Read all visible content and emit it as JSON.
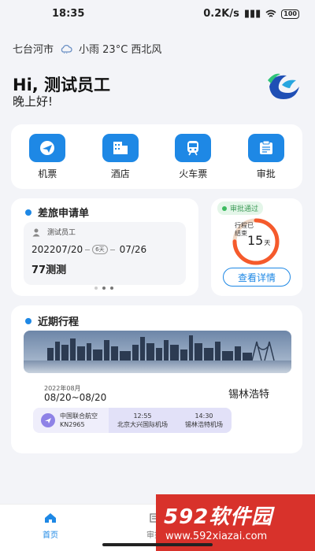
{
  "status_bar": {
    "time": "18:35",
    "speed": "0.2K/s",
    "battery": "100"
  },
  "weather": {
    "city": "七台河市",
    "condition": "小雨 23°C 西北风"
  },
  "greeting": {
    "hello": "Hi, 测试员工",
    "sub": "晚上好!"
  },
  "quick_actions": [
    {
      "label": "机票",
      "icon": "plane-icon"
    },
    {
      "label": "酒店",
      "icon": "hotel-icon"
    },
    {
      "label": "火车票",
      "icon": "train-icon"
    },
    {
      "label": "审批",
      "icon": "approval-icon"
    }
  ],
  "travel_request": {
    "title": "差旅申请单",
    "user": "测试员工",
    "date_start": "202207/20",
    "days": "6天",
    "date_end": "07/26",
    "name": "77测测"
  },
  "status_card": {
    "badge": "审批通过",
    "label_line1": "行程已",
    "label_line2": "结束",
    "days_value": "15",
    "days_unit": "天",
    "button": "查看详情",
    "progress": 0.75
  },
  "recent_trip": {
    "title": "近期行程",
    "month": "2022年08月",
    "date_range": "08/20~08/20",
    "destination": "锡林浩特",
    "airline": "中国联合航空",
    "flight_no": "KN2965",
    "dep_time": "12:55",
    "dep_airport": "北京大兴国际机场",
    "arr_time": "14:30",
    "arr_airport": "锡林浩特机场"
  },
  "tabbar": [
    {
      "label": "首页",
      "icon": "home-icon"
    },
    {
      "label": "审批",
      "icon": "approval-tab-icon"
    }
  ],
  "watermark": {
    "brand": "592软件园",
    "url": "www.592xiazai.com"
  },
  "colors": {
    "primary": "#1e88e5",
    "progress": "#f55a2c",
    "success": "#3dbb5f"
  }
}
